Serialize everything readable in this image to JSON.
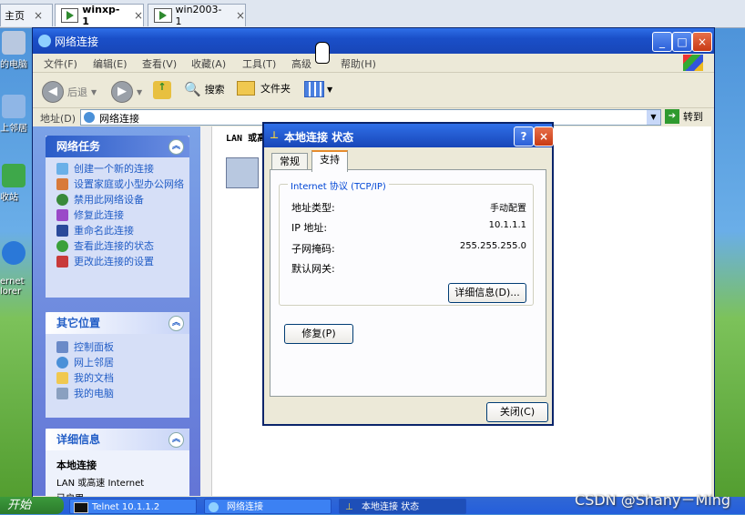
{
  "vm_tabs": {
    "home": "主页",
    "tab1": "winxp-1",
    "tab2": "win2003-1",
    "close": "×"
  },
  "desktop": {
    "icons": [
      "的电脑",
      "上邻居",
      "收站",
      "ernet\nlorer"
    ]
  },
  "window": {
    "title": "网络连接",
    "menu": [
      "文件(F)",
      "编辑(E)",
      "查看(V)",
      "收藏(A)",
      "工具(T)",
      "高级",
      "帮助(H)"
    ],
    "toolbar": {
      "back": "后退",
      "search": "搜索",
      "folders": "文件夹"
    },
    "address": {
      "label": "地址(D)",
      "value": "网络连接",
      "go": "转到"
    },
    "content_header": "LAN 或高"
  },
  "taskpane": {
    "network_tasks": {
      "title": "网络任务",
      "items": [
        "创建一个新的连接",
        "设置家庭或小型办公网络",
        "禁用此网络设备",
        "修复此连接",
        "重命名此连接",
        "查看此连接的状态",
        "更改此连接的设置"
      ]
    },
    "other_places": {
      "title": "其它位置",
      "items": [
        "控制面板",
        "网上邻居",
        "我的文档",
        "我的电脑"
      ]
    },
    "details": {
      "title": "详细信息",
      "name": "本地连接",
      "desc": "LAN 或高速 Internet",
      "status": "已启用"
    }
  },
  "dialog": {
    "title": "本地连接 状态",
    "tabs": [
      "常规",
      "支持"
    ],
    "group": "Internet 协议 (TCP/IP)",
    "rows": [
      {
        "label": "地址类型:",
        "value": "手动配置"
      },
      {
        "label": "IP 地址:",
        "value": "10.1.1.1"
      },
      {
        "label": "子网掩码:",
        "value": "255.255.255.0"
      },
      {
        "label": "默认网关:",
        "value": ""
      }
    ],
    "details_btn": "详细信息(D)...",
    "repair_btn": "修复(P)",
    "close_btn": "关闭(C)"
  },
  "taskbar": {
    "start": "开始",
    "tasks": [
      "Telnet 10.1.1.2",
      "网络连接",
      "本地连接 状态"
    ]
  },
  "watermark": "CSDN @Shany－Ming"
}
